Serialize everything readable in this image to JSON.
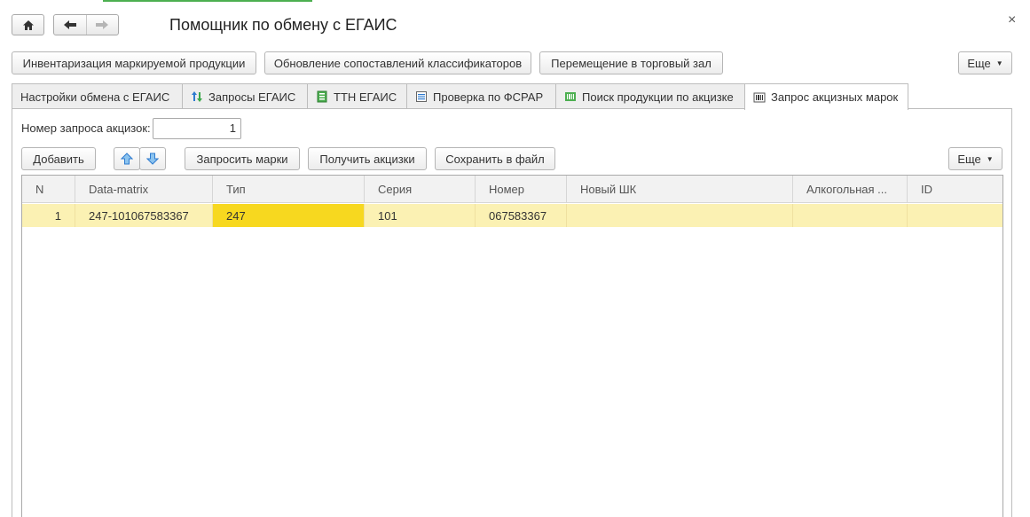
{
  "window": {
    "title": "Помощник по обмену с ЕГАИС",
    "close_glyph": "×"
  },
  "nav": {
    "home_icon": "home-icon",
    "back_icon": "arrow-left-icon",
    "forward_icon": "arrow-right-icon"
  },
  "top_buttons": {
    "inventory": "Инвентаризация маркируемой продукции",
    "update_mapping": "Обновление сопоставлений классификаторов",
    "move_to_hall": "Перемещение в торговый зал",
    "more": "Еще"
  },
  "tabs": [
    {
      "label": "Настройки обмена с ЕГАИС",
      "icon": ""
    },
    {
      "label": "Запросы ЕГАИС",
      "icon": "exchange-arrows-icon"
    },
    {
      "label": "ТТН ЕГАИС",
      "icon": "document-green-icon"
    },
    {
      "label": "Проверка по ФСРАР",
      "icon": "checklist-icon"
    },
    {
      "label": "Поиск продукции по акцизке",
      "icon": "barcode-green-icon"
    },
    {
      "label": "Запрос акцизных марок",
      "icon": "barcode-icon"
    }
  ],
  "form": {
    "request_number_label": "Номер запроса акцизок:",
    "request_number_value": "1"
  },
  "toolbar": {
    "add": "Добавить",
    "request_marks": "Запросить марки",
    "get_excise": "Получить акцизки",
    "save_to_file": "Сохранить в файл",
    "more": "Еще"
  },
  "table": {
    "columns": [
      "N",
      "Data-matrix",
      "Тип",
      "Серия",
      "Номер",
      "Новый ШК",
      "Алкогольная ...",
      "ID"
    ],
    "rows": [
      [
        "1",
        "247-101067583367",
        "247",
        "101",
        "067583367",
        "",
        "",
        ""
      ]
    ]
  },
  "colors": {
    "accent_green": "#4caf50",
    "row_highlight": "#fbf1b3",
    "cell_selected": "#f7d81f"
  }
}
